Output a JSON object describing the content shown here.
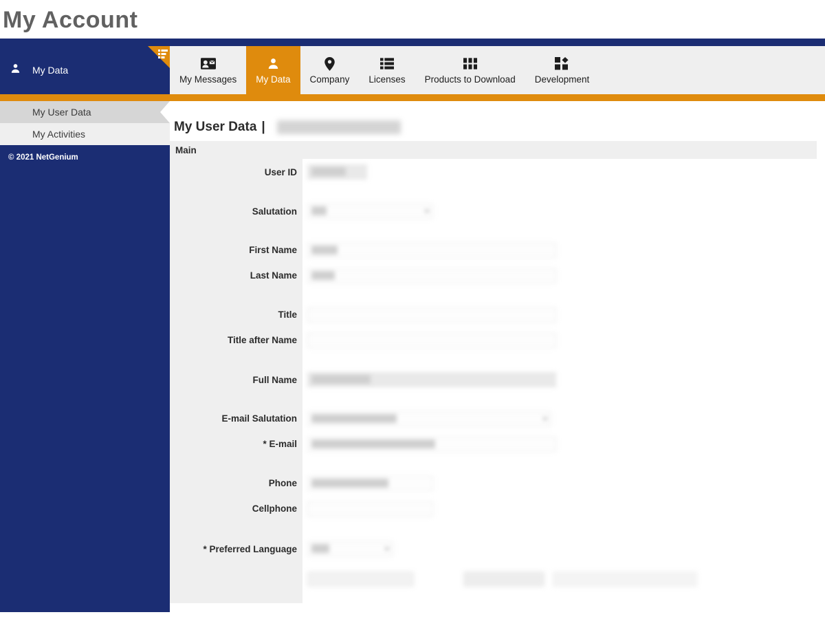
{
  "page": {
    "title": "My Account"
  },
  "sidebar": {
    "header": {
      "label": "My Data",
      "icon": "user-icon",
      "corner_icon": "list-corner-icon"
    },
    "items": [
      {
        "label": "My User Data",
        "selected": true
      },
      {
        "label": "My Activities",
        "selected": false
      }
    ],
    "copyright": "© 2021 NetGenium"
  },
  "tabs": [
    {
      "label": "My Messages",
      "icon": "contact-card-icon",
      "active": false
    },
    {
      "label": "My Data",
      "icon": "user-icon",
      "active": true
    },
    {
      "label": "Company",
      "icon": "location-pin-icon",
      "active": false
    },
    {
      "label": "Licenses",
      "icon": "list-icon",
      "active": false
    },
    {
      "label": "Products to Download",
      "icon": "grid-icon",
      "active": false
    },
    {
      "label": "Development",
      "icon": "blocks-diamond-icon",
      "active": false
    }
  ],
  "content": {
    "heading": "My User Data",
    "heading_separator": "|",
    "heading_value_redacted": "",
    "section_title": "Main",
    "fields": [
      {
        "label": "User ID",
        "type": "text-readonly",
        "value": "",
        "redacted": true
      },
      {
        "label": "Salutation",
        "type": "select",
        "value": "",
        "redacted": true
      },
      {
        "label": "First Name",
        "type": "text",
        "value": "",
        "redacted": true
      },
      {
        "label": "Last Name",
        "type": "text",
        "value": "",
        "redacted": true
      },
      {
        "label": "Title",
        "type": "text",
        "value": "",
        "redacted": false
      },
      {
        "label": "Title after Name",
        "type": "text",
        "value": "",
        "redacted": false
      },
      {
        "label": "Full Name",
        "type": "text-readonly",
        "value": "",
        "redacted": true
      },
      {
        "label": "E-mail Salutation",
        "type": "select",
        "value": "",
        "redacted": true
      },
      {
        "label": "* E-mail",
        "type": "text",
        "value": "",
        "redacted": true
      },
      {
        "label": "Phone",
        "type": "text",
        "value": "",
        "redacted": true
      },
      {
        "label": "Cellphone",
        "type": "text",
        "value": "",
        "redacted": false
      },
      {
        "label": "* Preferred Language",
        "type": "select",
        "value": "",
        "redacted": true
      }
    ],
    "footer_actions": [
      {
        "label": "",
        "redacted": true
      },
      {
        "label": "",
        "redacted": true
      },
      {
        "label": "",
        "redacted": true
      }
    ]
  },
  "colors": {
    "navy": "#1b2d73",
    "orange": "#df8b0d",
    "panel_gray": "#efefef",
    "selected_gray": "#d6d6d6",
    "title_gray": "#616161"
  }
}
